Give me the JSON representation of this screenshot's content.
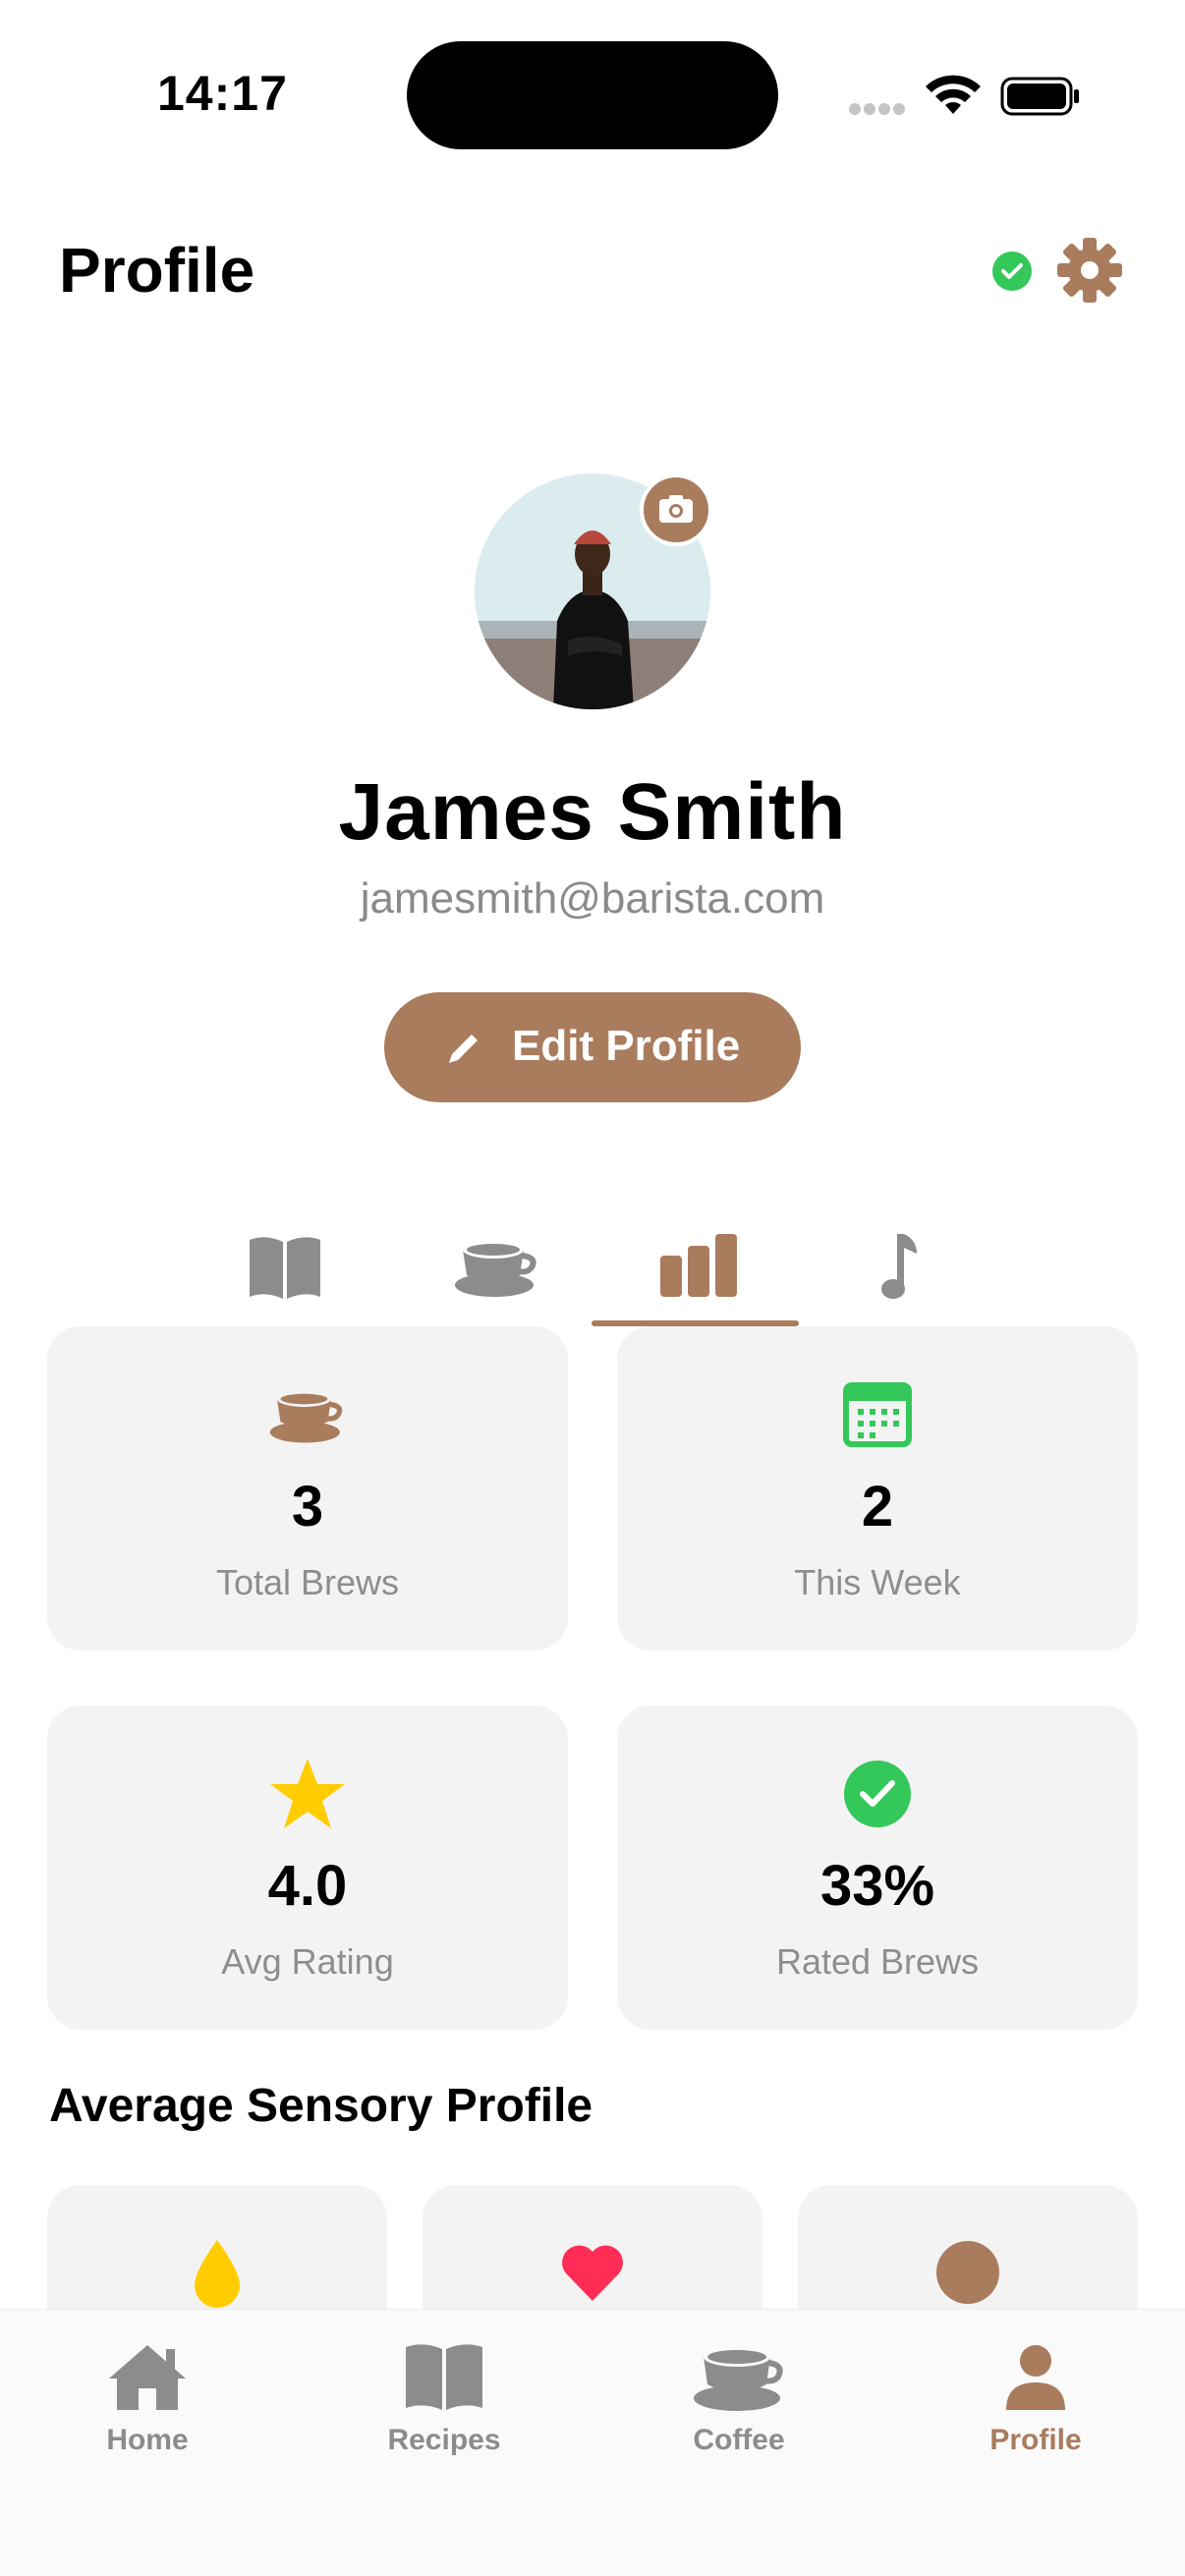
{
  "status_bar": {
    "time": "14:17"
  },
  "header": {
    "title": "Profile"
  },
  "profile": {
    "name": "James Smith",
    "email": "jamesmith@barista.com",
    "edit_label": "Edit Profile"
  },
  "tabs": [
    {
      "icon": "book-icon",
      "active": false
    },
    {
      "icon": "coffee-cup-icon",
      "active": false
    },
    {
      "icon": "bar-chart-icon",
      "active": true
    },
    {
      "icon": "music-note-icon",
      "active": false
    }
  ],
  "stats": [
    {
      "icon": "coffee-cup-icon",
      "value": "3",
      "label": "Total Brews"
    },
    {
      "icon": "calendar-icon",
      "value": "2",
      "label": "This Week"
    },
    {
      "icon": "star-icon",
      "value": "4.0",
      "label": "Avg Rating"
    },
    {
      "icon": "check-circle-icon",
      "value": "33%",
      "label": "Rated Brews"
    }
  ],
  "sensory": {
    "title": "Average Sensory Profile",
    "icons": [
      "drop-icon",
      "heart-icon",
      "circle-icon"
    ]
  },
  "tabbar": [
    {
      "label": "Home",
      "icon": "house-icon",
      "active": false
    },
    {
      "label": "Recipes",
      "icon": "book-icon",
      "active": false
    },
    {
      "label": "Coffee",
      "icon": "coffee-cup-icon",
      "active": false
    },
    {
      "label": "Profile",
      "icon": "person-icon",
      "active": true
    }
  ],
  "colors": {
    "accent": "#a97c5e",
    "green": "#34c759",
    "star": "#ffcc00",
    "heart": "#ff2d55",
    "inactive": "#8c8c8c",
    "card": "#f3f3f3"
  }
}
